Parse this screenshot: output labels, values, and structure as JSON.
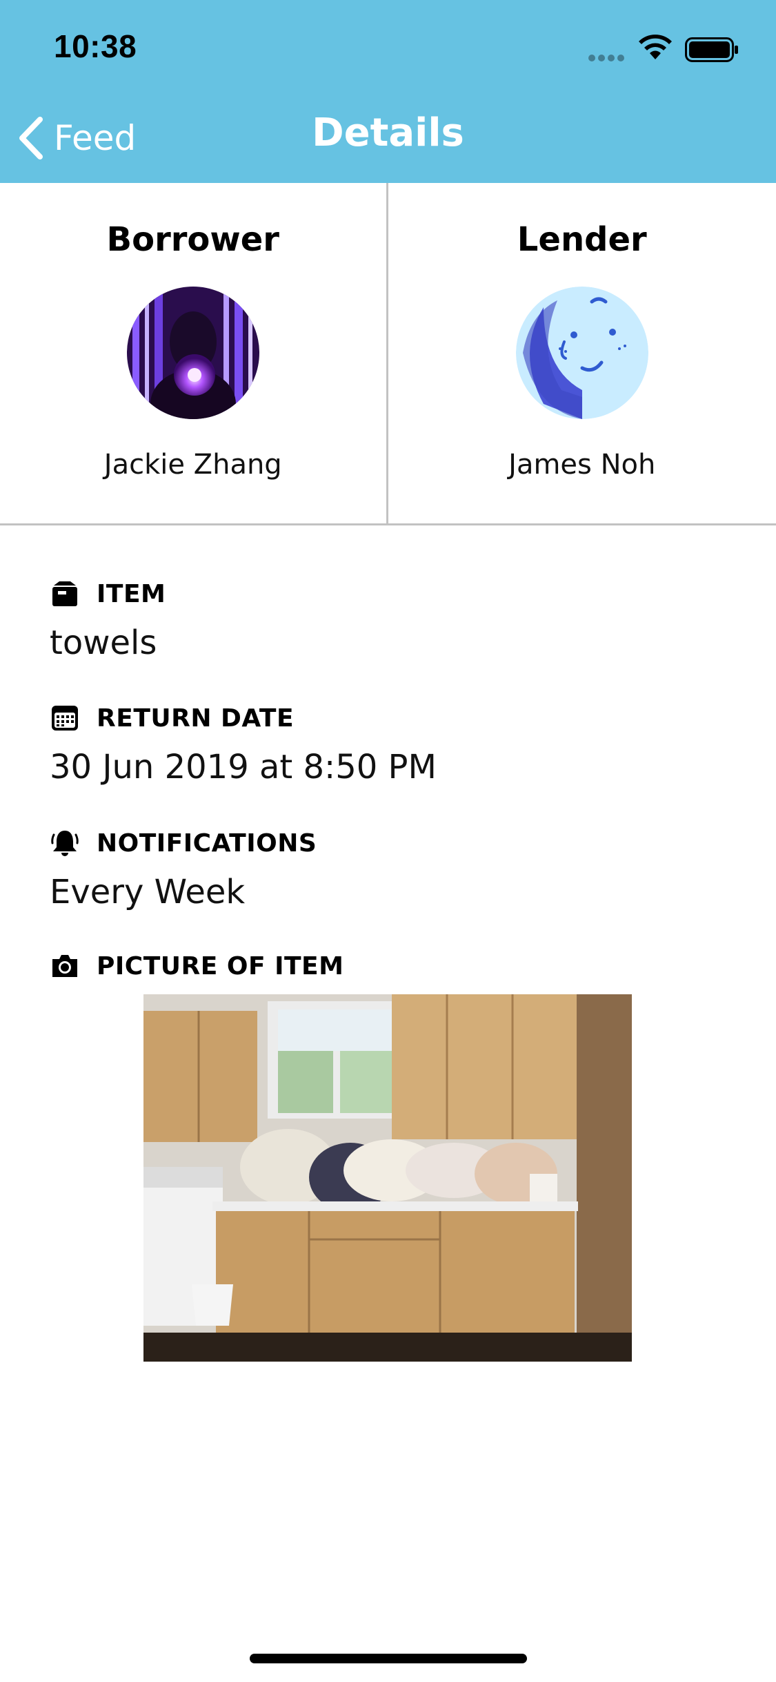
{
  "status_bar": {
    "time": "10:38",
    "signal_icon": "signal-dots-icon",
    "wifi_icon": "wifi-icon",
    "battery_icon": "battery-icon"
  },
  "nav": {
    "back_icon": "chevron-left-icon",
    "back_label": "Feed",
    "title": "Details",
    "background_color": "#66C2E2"
  },
  "borrower": {
    "role": "Borrower",
    "name": "Jackie Zhang"
  },
  "lender": {
    "role": "Lender",
    "name": "James Noh"
  },
  "details": {
    "item": {
      "icon": "box-icon",
      "label": "ITEM",
      "value": "towels"
    },
    "return_date": {
      "icon": "calendar-icon",
      "label": "RETURN DATE",
      "value": "30 Jun 2019 at 8:50 PM"
    },
    "notifications": {
      "icon": "bell-icon",
      "label": "NOTIFICATIONS",
      "value": "Every Week"
    },
    "picture": {
      "icon": "camera-icon",
      "label": "PICTURE OF ITEM"
    }
  }
}
